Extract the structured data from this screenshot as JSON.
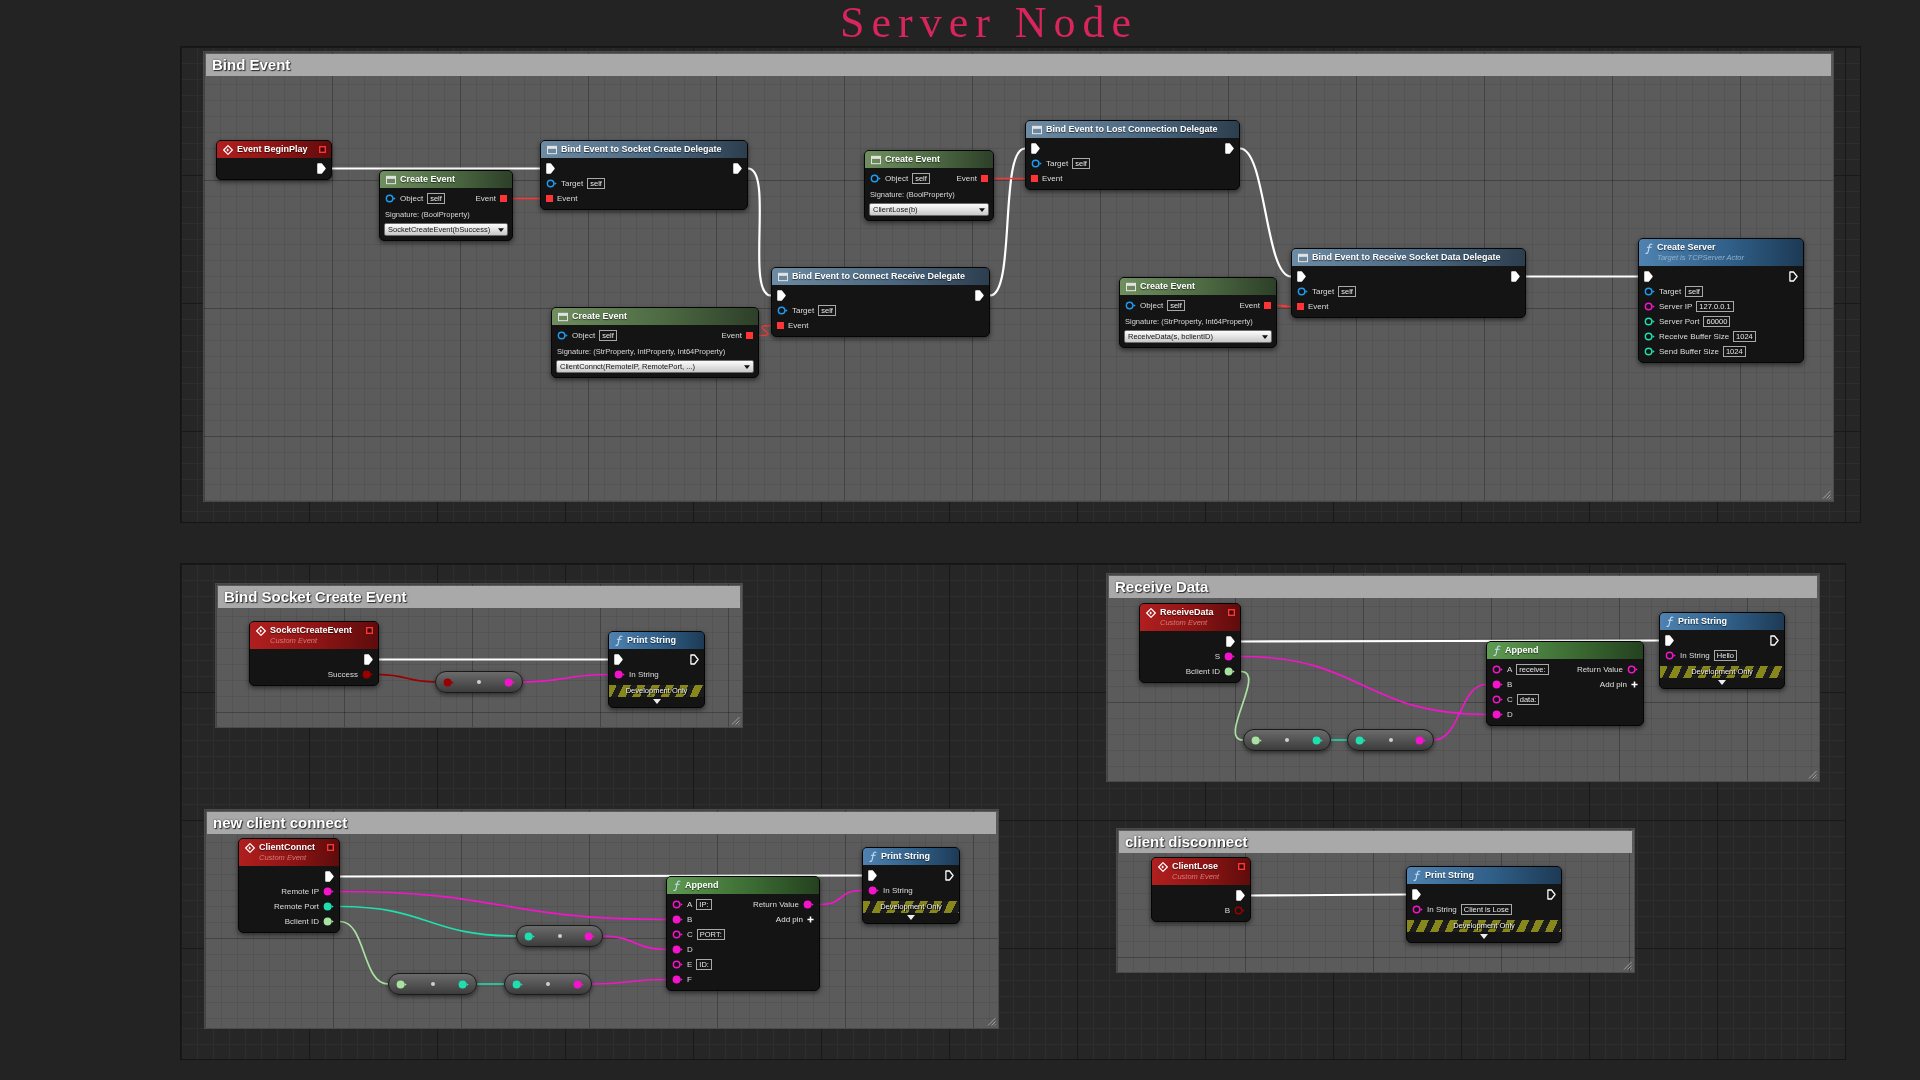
{
  "title": "Server Node",
  "comments": [
    {
      "title": "Bind Event",
      "nodes": [
        {
          "kind": "event",
          "title": "Event BeginPlay",
          "outputs": [
            {
              "kind": "exec",
              "connected": true
            }
          ]
        },
        {
          "kind": "create_event",
          "title": "Create Event",
          "inputs": [
            {
              "kind": "object",
              "label": "Object",
              "value": "self",
              "connected": false
            }
          ],
          "outputs": [
            {
              "kind": "delegate",
              "label": "Event",
              "connected": true
            }
          ],
          "signature": "Signature: (BoolProperty)",
          "function": "SocketCreateEvent(bSuccess)"
        },
        {
          "kind": "bind",
          "title": "Bind Event to Socket Create Delegate",
          "inputs": [
            {
              "kind": "exec",
              "connected": true
            },
            {
              "kind": "object",
              "label": "Target",
              "value": "self",
              "connected": false
            },
            {
              "kind": "delegate",
              "label": "Event",
              "connected": true
            }
          ],
          "outputs": [
            {
              "kind": "exec",
              "connected": true
            }
          ]
        },
        {
          "kind": "create_event",
          "title": "Create Event",
          "inputs": [
            {
              "kind": "object",
              "label": "Object",
              "value": "self",
              "connected": false
            }
          ],
          "outputs": [
            {
              "kind": "delegate",
              "label": "Event",
              "connected": true
            }
          ],
          "signature": "Signature: (BoolProperty)",
          "function": "ClientLose(b)"
        },
        {
          "kind": "bind",
          "title": "Bind Event to Lost Connection Delegate",
          "inputs": [
            {
              "kind": "exec",
              "connected": true
            },
            {
              "kind": "object",
              "label": "Target",
              "value": "self",
              "connected": false
            },
            {
              "kind": "delegate",
              "label": "Event",
              "connected": true
            }
          ],
          "outputs": [
            {
              "kind": "exec",
              "connected": true
            }
          ]
        },
        {
          "kind": "create_event",
          "title": "Create Event",
          "inputs": [
            {
              "kind": "object",
              "label": "Object",
              "value": "self",
              "connected": false
            }
          ],
          "outputs": [
            {
              "kind": "delegate",
              "label": "Event",
              "connected": true
            }
          ],
          "signature": "Signature: (StrProperty, IntProperty, Int64Property)",
          "function": "ClientConnct(RemoteIP, RemotePort, ...)"
        },
        {
          "kind": "bind",
          "title": "Bind Event to Connect Receive Delegate",
          "inputs": [
            {
              "kind": "exec",
              "connected": true
            },
            {
              "kind": "object",
              "label": "Target",
              "value": "self",
              "connected": false
            },
            {
              "kind": "delegate",
              "label": "Event",
              "connected": true
            }
          ],
          "outputs": [
            {
              "kind": "exec",
              "connected": true
            }
          ]
        },
        {
          "kind": "create_event",
          "title": "Create Event",
          "inputs": [
            {
              "kind": "object",
              "label": "Object",
              "value": "self",
              "connected": false
            }
          ],
          "outputs": [
            {
              "kind": "delegate",
              "label": "Event",
              "connected": true
            }
          ],
          "signature": "Signature: (StrProperty, Int64Property)",
          "function": "ReceiveData(s, bclientID)"
        },
        {
          "kind": "bind",
          "title": "Bind Event to Receive Socket Data Delegate",
          "inputs": [
            {
              "kind": "exec",
              "connected": true
            },
            {
              "kind": "object",
              "label": "Target",
              "value": "self",
              "connected": false
            },
            {
              "kind": "delegate",
              "label": "Event",
              "connected": true
            }
          ],
          "outputs": [
            {
              "kind": "exec",
              "connected": true
            }
          ]
        },
        {
          "kind": "function",
          "title": "Create Server",
          "subtitle": "Target is TCPServer Actor",
          "inputs": [
            {
              "kind": "exec",
              "connected": true
            },
            {
              "kind": "object",
              "label": "Target",
              "value": "self",
              "connected": false
            },
            {
              "kind": "string",
              "label": "Server IP",
              "value": "127.0.0.1",
              "connected": false
            },
            {
              "kind": "int",
              "label": "Server Port",
              "value": "60000",
              "connected": false
            },
            {
              "kind": "int",
              "label": "Receive Buffer Size",
              "value": "1024",
              "connected": false
            },
            {
              "kind": "int",
              "label": "Send Buffer Size",
              "value": "1024",
              "connected": false
            }
          ],
          "outputs": [
            {
              "kind": "exec",
              "connected": false
            }
          ]
        }
      ]
    },
    {
      "title": "Bind Socket Create Event",
      "nodes": [
        {
          "kind": "custom_event",
          "title": "SocketCreateEvent",
          "subtitle": "Custom Event",
          "outputs": [
            {
              "kind": "exec",
              "connected": true
            },
            {
              "kind": "bool",
              "label": "Success",
              "connected": true
            }
          ]
        },
        {
          "kind": "conversion",
          "inputs": [
            {
              "kind": "bool",
              "connected": true
            }
          ],
          "outputs": [
            {
              "kind": "string",
              "connected": true
            }
          ]
        },
        {
          "kind": "function",
          "title": "Print String",
          "inputs": [
            {
              "kind": "exec",
              "connected": true
            },
            {
              "kind": "string",
              "label": "In String",
              "connected": true
            }
          ],
          "outputs": [
            {
              "kind": "exec",
              "connected": false
            }
          ],
          "banner": "Development Only"
        }
      ]
    },
    {
      "title": "Receive Data",
      "nodes": [
        {
          "kind": "custom_event",
          "title": "ReceiveData",
          "subtitle": "Custom Event",
          "outputs": [
            {
              "kind": "exec",
              "connected": true
            },
            {
              "kind": "string",
              "label": "S",
              "connected": true
            },
            {
              "kind": "int64",
              "label": "Bclient ID",
              "connected": true
            }
          ]
        },
        {
          "kind": "pure_function",
          "title": "Append",
          "inputs": [
            {
              "kind": "string",
              "label": "A",
              "value": "receive:",
              "connected": false
            },
            {
              "kind": "string",
              "label": "B",
              "connected": true
            },
            {
              "kind": "string",
              "label": "C",
              "value": "data:",
              "connected": false
            },
            {
              "kind": "string",
              "label": "D",
              "connected": true
            }
          ],
          "outputs": [
            {
              "kind": "string",
              "label": "Return Value",
              "connected": false
            }
          ],
          "add_pin": "Add pin"
        },
        {
          "kind": "function",
          "title": "Print String",
          "inputs": [
            {
              "kind": "exec",
              "connected": true
            },
            {
              "kind": "string",
              "label": "In String",
              "value": "Hello",
              "connected": false
            }
          ],
          "outputs": [
            {
              "kind": "exec",
              "connected": false
            }
          ],
          "banner": "Development Only"
        },
        {
          "kind": "conversion",
          "inputs": [
            {
              "kind": "int64",
              "connected": true
            }
          ],
          "outputs": [
            {
              "kind": "int",
              "connected": true
            }
          ]
        },
        {
          "kind": "conversion",
          "inputs": [
            {
              "kind": "int",
              "connected": true
            }
          ],
          "outputs": [
            {
              "kind": "string",
              "connected": true
            }
          ]
        }
      ]
    },
    {
      "title": "new client connect",
      "nodes": [
        {
          "kind": "custom_event",
          "title": "ClientConnct",
          "subtitle": "Custom Event",
          "outputs": [
            {
              "kind": "exec",
              "connected": true
            },
            {
              "kind": "string",
              "label": "Remote IP",
              "connected": true
            },
            {
              "kind": "int",
              "label": "Remote Port",
              "connected": true
            },
            {
              "kind": "int64",
              "label": "Bclient ID",
              "connected": true
            }
          ]
        },
        {
          "kind": "pure_function",
          "title": "Append",
          "inputs": [
            {
              "kind": "string",
              "label": "A",
              "value": "IP:",
              "connected": false
            },
            {
              "kind": "string",
              "label": "B",
              "connected": true
            },
            {
              "kind": "string",
              "label": "C",
              "value": "PORT:",
              "connected": false
            },
            {
              "kind": "string",
              "label": "D",
              "connected": true
            },
            {
              "kind": "string",
              "label": "E",
              "value": "ID:",
              "connected": false
            },
            {
              "kind": "string",
              "label": "F",
              "connected": true
            }
          ],
          "outputs": [
            {
              "kind": "string",
              "label": "Return Value",
              "connected": true
            }
          ],
          "add_pin": "Add pin"
        },
        {
          "kind": "function",
          "title": "Print String",
          "inputs": [
            {
              "kind": "exec",
              "connected": true
            },
            {
              "kind": "string",
              "label": "In String",
              "connected": true
            }
          ],
          "outputs": [
            {
              "kind": "exec",
              "connected": false
            }
          ],
          "banner": "Development Only"
        },
        {
          "kind": "conversion",
          "inputs": [
            {
              "kind": "int",
              "connected": true
            }
          ],
          "outputs": [
            {
              "kind": "string",
              "connected": true
            }
          ]
        },
        {
          "kind": "conversion",
          "inputs": [
            {
              "kind": "int64",
              "connected": true
            }
          ],
          "outputs": [
            {
              "kind": "int",
              "connected": true
            }
          ]
        },
        {
          "kind": "conversion",
          "inputs": [
            {
              "kind": "int",
              "connected": true
            }
          ],
          "outputs": [
            {
              "kind": "string",
              "connected": true
            }
          ]
        }
      ]
    },
    {
      "title": "client disconnect",
      "nodes": [
        {
          "kind": "custom_event",
          "title": "ClientLose",
          "subtitle": "Custom Event",
          "outputs": [
            {
              "kind": "exec",
              "connected": true
            },
            {
              "kind": "bool",
              "label": "B",
              "connected": false
            }
          ]
        },
        {
          "kind": "function",
          "title": "Print String",
          "inputs": [
            {
              "kind": "exec",
              "connected": true
            },
            {
              "kind": "string",
              "label": "In String",
              "value": "Client is Lose",
              "connected": false
            }
          ],
          "outputs": [
            {
              "kind": "exec",
              "connected": false
            }
          ],
          "banner": "Development Only"
        }
      ]
    }
  ]
}
